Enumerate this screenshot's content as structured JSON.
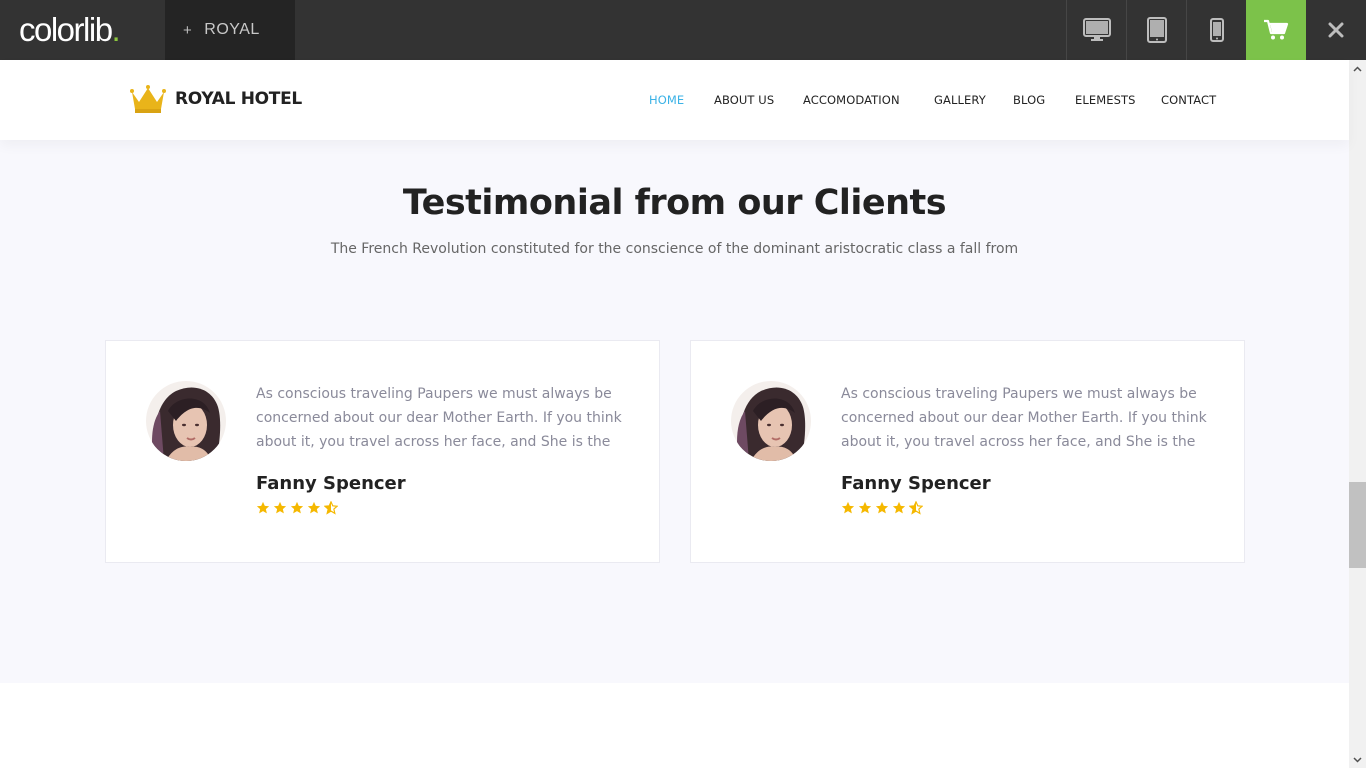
{
  "preview_bar": {
    "brand": "colorlib",
    "brand_dot": ".",
    "theme_plus": "+",
    "theme_name": "ROYAL",
    "devices": [
      "desktop-icon",
      "tablet-icon",
      "mobile-icon"
    ],
    "cart_icon": "cart-icon",
    "close_icon": "close-icon",
    "accent": "#7cc24a"
  },
  "site": {
    "logo_text": "ROYAL HOTEL",
    "nav": [
      {
        "label": "HOME",
        "active": true
      },
      {
        "label": "ABOUT US",
        "active": false
      },
      {
        "label": "ACCOMODATION",
        "active": false
      },
      {
        "label": "GALLERY",
        "active": false
      },
      {
        "label": "BLOG",
        "active": false
      },
      {
        "label": "ELEMESTS",
        "active": false
      },
      {
        "label": "CONTACT",
        "active": false
      }
    ],
    "nav_active_color": "#3bb2e6"
  },
  "testimonials": {
    "title": "Testimonial from our Clients",
    "subtitle": "The French Revolution constituted for the conscience of the dominant aristocratic class a fall from",
    "items": [
      {
        "quote": "As conscious traveling Paupers we must always be concerned about our dear Mother Earth. If you think about it, you travel across her face, and She is the",
        "name": "Fanny Spencer",
        "rating": 4.5
      },
      {
        "quote": "As conscious traveling Paupers we must always be concerned about our dear Mother Earth. If you think about it, you travel across her face, and She is the",
        "name": "Fanny Spencer",
        "rating": 4.5
      }
    ],
    "star_color": "#f5b800"
  }
}
